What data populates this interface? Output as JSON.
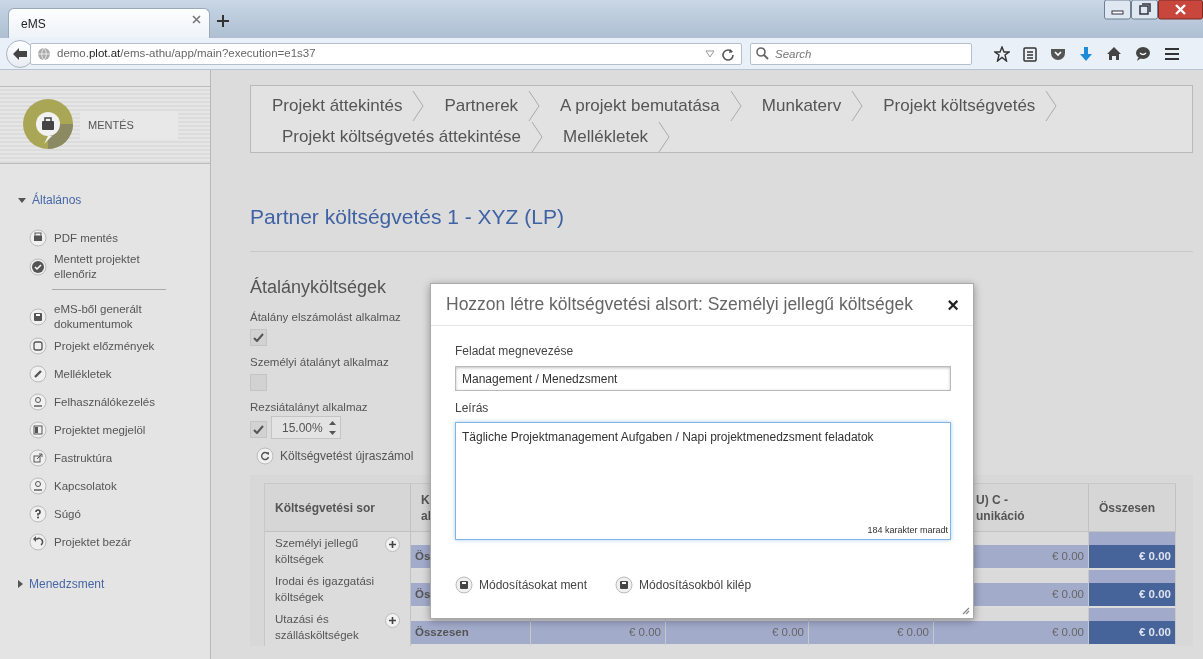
{
  "browser": {
    "tabs": [
      {
        "label": "eMS",
        "selected": true
      }
    ],
    "url": "demo.**plot.at**/ems-athu/app/main?execution=e1s37",
    "search": {
      "placeholder": "Search"
    }
  },
  "sidebar": {
    "save_label": "MENTÉS",
    "sections": [
      {
        "label": "Általános",
        "expanded": true,
        "groups": [
          {
            "items": [
              {
                "label": "PDF mentés"
              },
              {
                "label": "Mentett projektet ellenőriz"
              }
            ]
          },
          {
            "items": [
              {
                "label": "eMS-ből generált dokumentumok"
              },
              {
                "label": "Projekt előzmények"
              },
              {
                "label": "Mellékletek"
              },
              {
                "label": "Felhasználókezelés"
              },
              {
                "label": "Projektet megjelöl"
              },
              {
                "label": "Fastruktúra"
              },
              {
                "label": "Kapcsolatok"
              },
              {
                "label": "Súgó"
              },
              {
                "label": "Projektet bezár"
              }
            ]
          }
        ]
      },
      {
        "label": "Menedzsment",
        "expanded": false
      }
    ]
  },
  "main": {
    "step_rows": [
      [
        {
          "label": "Projekt áttekintés",
          "selected": false
        },
        {
          "label": "Partnerek",
          "selected": false
        },
        {
          "label": "A projekt bemutatása",
          "selected": false
        },
        {
          "label": "Munkaterv",
          "selected": false
        },
        {
          "label": "Projekt költségvetés",
          "selected": false
        }
      ],
      [
        {
          "label": "Projekt költségvetés áttekintése",
          "selected": false
        },
        {
          "label": "Mellékletek",
          "selected": false
        }
      ]
    ],
    "title": "Partner költségvetés 1 - XYZ (LP)",
    "section_title": "Átalányköltségek",
    "options": [
      {
        "label": "Átalány elszámolást alkalmaz",
        "checked": true
      },
      {
        "label": "Személyi átalányt alkalmaz",
        "checked": false
      },
      {
        "label": "Rezsiátalányt alkalmaz",
        "checked": true,
        "value": "15.00%"
      }
    ],
    "recalc_button": "Költségvetést újraszámol",
    "table": {
      "columns": [
        {
          "heading": "Költségvetési sor"
        },
        {
          "heading": "K\nal"
        },
        {},
        {},
        {},
        {
          "heading": "U) C -\nunikáció"
        },
        {
          "heading": "Összesen"
        }
      ],
      "rows": [
        {
          "addable": true,
          "cells": [
            "Személyi jellegű költségek",
            "Ös",
            "",
            "",
            "",
            "€ 0.00",
            "€ 0.00"
          ]
        },
        {
          "addable": false,
          "cells": [
            "Irodai és igazgatási költségek",
            "Ös",
            "",
            "",
            "",
            "€ 0.00",
            "€ 0.00"
          ]
        },
        {
          "addable": true,
          "cells": [
            "Utazási és szállásköltségek",
            "Összesen",
            "€ 0.00",
            "€ 0.00",
            "€ 0.00",
            "€ 0.00",
            "€ 0.00"
          ]
        }
      ]
    }
  },
  "dialog": {
    "title": "Hozzon létre költségvetési alsort: Személyi jellegű költségek",
    "close": "×",
    "name_label": "Feladat megnevezése",
    "name_value": "Management / Menedzsment",
    "description_label": "Leírás",
    "description_value": "Tägliche Projektmanagement Aufgaben / Napi projektmenedzsment feladatok",
    "counter": "184 karakter maradt",
    "buttons": [
      "Módosításokat ment",
      "Módosításokból kilép"
    ]
  }
}
